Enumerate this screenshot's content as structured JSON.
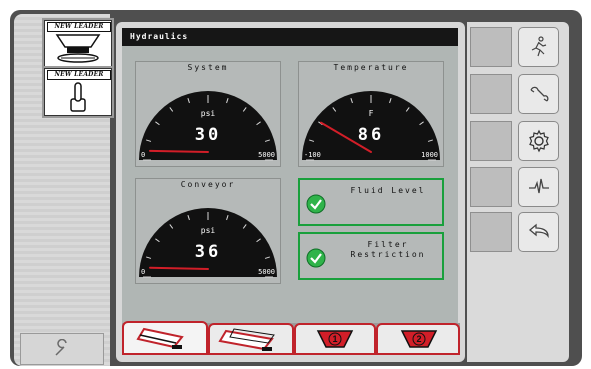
{
  "brand_text": "NEW LEADER",
  "screen_title": "Hydraulics",
  "gauges": [
    {
      "title": "System",
      "unit": "psi",
      "value": "30",
      "min_label": "0",
      "max_label": "5000",
      "reading": 30,
      "min": 0,
      "max": 5000
    },
    {
      "title": "Temperature",
      "unit": "F",
      "value": "86",
      "min_label": "-100",
      "max_label": "1000",
      "reading": 86,
      "min": -100,
      "max": 1000
    },
    {
      "title": "Conveyor",
      "unit": "psi",
      "value": "36",
      "min_label": "0",
      "max_label": "5000",
      "reading": 36,
      "min": 0,
      "max": 5000
    }
  ],
  "status": [
    {
      "label": "Fluid Level",
      "state": "ok"
    },
    {
      "label": "Filter Restriction",
      "state": "ok"
    }
  ],
  "bottom_tabs": [
    {
      "name": "hopper-tab",
      "active": true
    },
    {
      "name": "dual-bin-tab",
      "active": false
    },
    {
      "name": "spinner-1-tab",
      "badge": "1",
      "active": false
    },
    {
      "name": "spinner-2-tab",
      "badge": "2",
      "active": false
    }
  ],
  "right_buttons": [
    "running-person-icon",
    "wrench-icon",
    "gear-icon",
    "pulse-icon",
    "back-arrow-icon"
  ],
  "colors": {
    "accent_red": "#c0232b",
    "ok_green": "#19a03c",
    "gauge_black": "#111111",
    "needle_red": "#d21e28"
  }
}
